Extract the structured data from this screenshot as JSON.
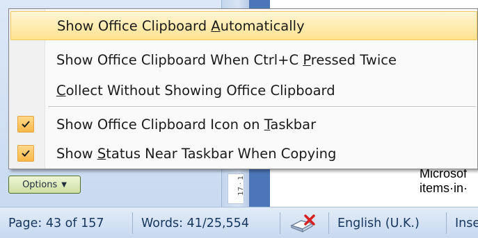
{
  "menu": {
    "items": [
      {
        "before": "Show Office Clipboard ",
        "key": "A",
        "after": "utomatically",
        "checked": false
      },
      {
        "before": "Show Office Clipboard When Ctrl+C ",
        "key": "P",
        "after": "ressed Twice",
        "checked": false
      },
      {
        "before": "",
        "key": "C",
        "after": "ollect Without Showing Office Clipboard",
        "checked": false
      },
      {
        "before": "Show Office Clipboard Icon on ",
        "key": "T",
        "after": "askbar",
        "checked": true
      },
      {
        "before": "Show ",
        "key": "S",
        "after": "tatus Near Taskbar When Copying",
        "checked": true
      }
    ]
  },
  "options_button": {
    "label": "Options",
    "caret_icon": "triangle-down"
  },
  "ruler": {
    "number": "17 · 1"
  },
  "document": {
    "line1": "Microsof",
    "line2": "items·in·"
  },
  "status_bar": {
    "page": "Page: 43 of 157",
    "words": "Words: 41/25,554",
    "proofing_icon": "book-with-red-x-icon",
    "language": "English (U.K.)",
    "mode": "Inse"
  },
  "colors": {
    "highlight": "#ffe28f",
    "check_fill": "#f8b848",
    "status_text": "#15365f"
  }
}
